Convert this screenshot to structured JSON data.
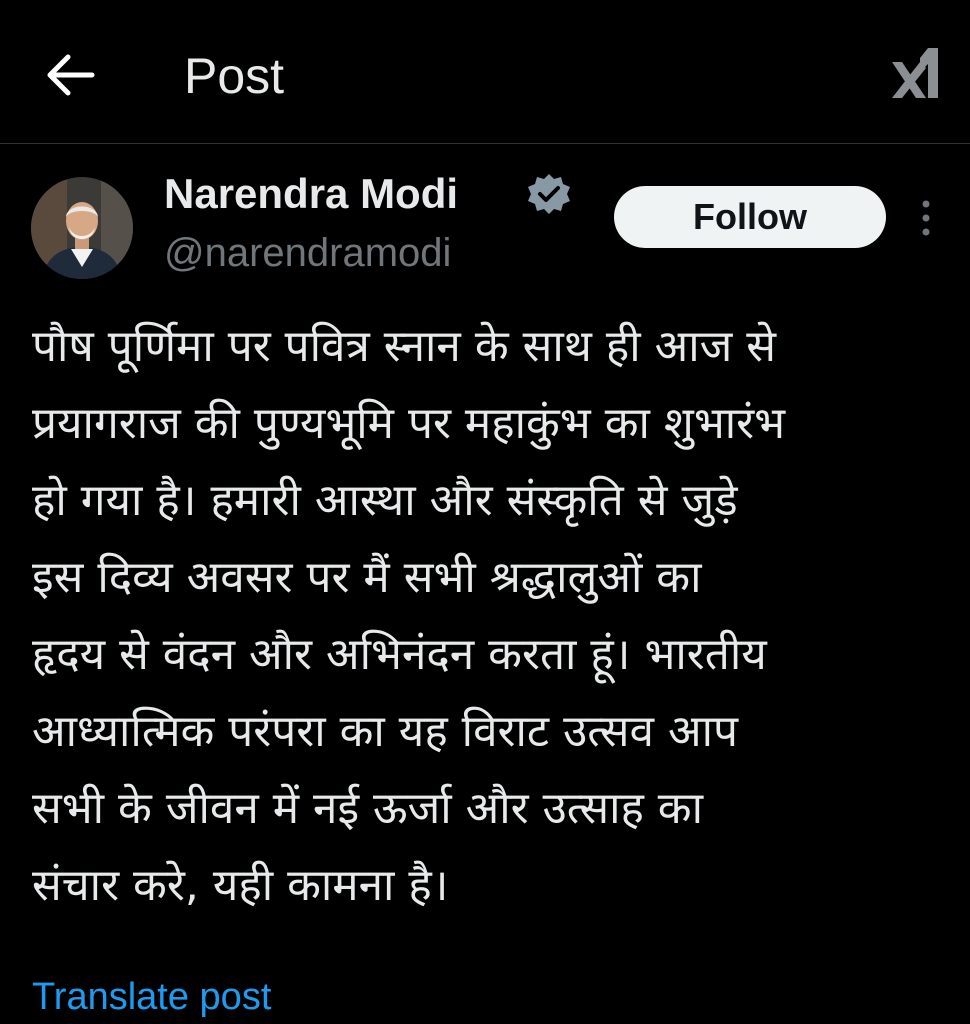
{
  "header": {
    "title": "Post",
    "back_icon": "arrow-left-icon",
    "grok_icon": "grok-icon"
  },
  "author": {
    "name": "Narendra Modi",
    "handle": "@narendramodi",
    "verified": true,
    "verified_icon": "verified-badge-icon",
    "avatar": "avatar-photo"
  },
  "actions": {
    "follow_label": "Follow",
    "more_icon": "more-vertical-icon"
  },
  "post": {
    "lines": [
      "पौष पूर्णिमा पर पवित्र स्नान के साथ ही आज से",
      "प्रयागराज की पुण्यभूमि पर महाकुंभ का शुभारंभ",
      "हो गया है। हमारी आस्था और संस्कृति से जुड़े",
      "इस दिव्य अवसर पर मैं सभी श्रद्धालुओं का",
      "हृदय से वंदन और अभिनंदन करता हूं। भारतीय",
      "आध्यात्मिक परंपरा का यह विराट उत्सव आप",
      "सभी के जीवन में नई ऊर्जा और उत्साह का",
      "संचार करे, यही कामना है।"
    ],
    "translate_label": "Translate post"
  },
  "colors": {
    "background": "#000000",
    "text": "#e7e9ea",
    "muted": "#71767b",
    "link": "#1d9bf0",
    "verified": "#8899a6",
    "follow_bg": "#eff3f4",
    "divider": "#2f3336"
  }
}
